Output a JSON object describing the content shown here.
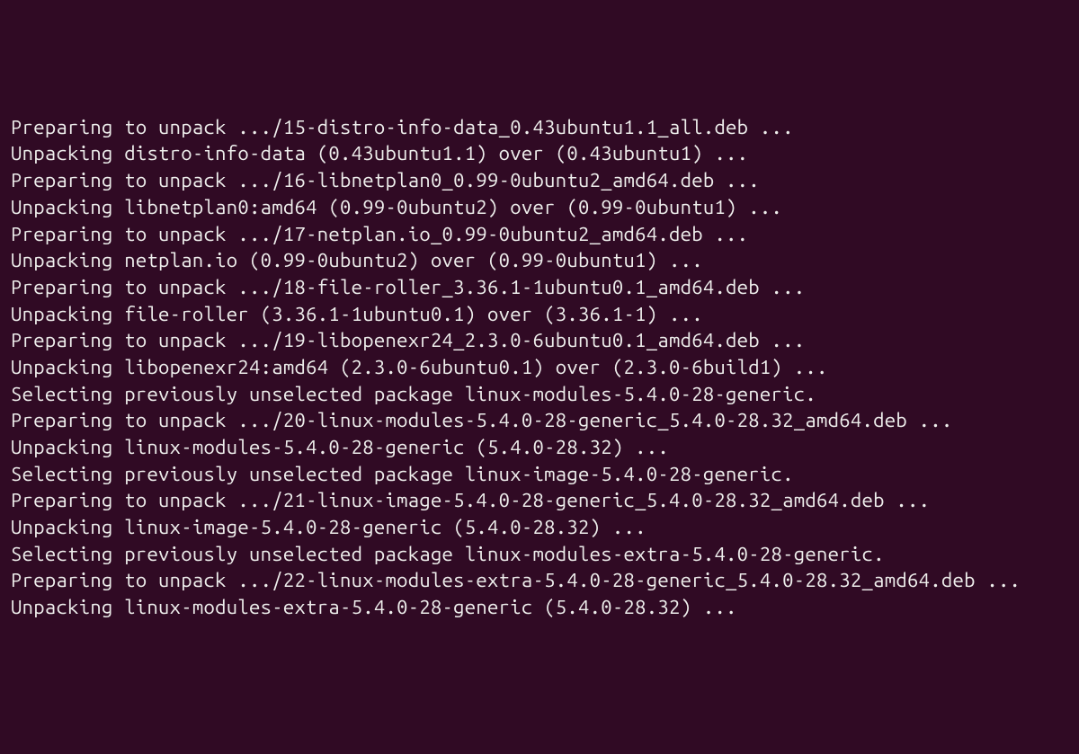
{
  "terminal": {
    "lines": [
      "Preparing to unpack .../15-distro-info-data_0.43ubuntu1.1_all.deb ...",
      "Unpacking distro-info-data (0.43ubuntu1.1) over (0.43ubuntu1) ...",
      "Preparing to unpack .../16-libnetplan0_0.99-0ubuntu2_amd64.deb ...",
      "Unpacking libnetplan0:amd64 (0.99-0ubuntu2) over (0.99-0ubuntu1) ...",
      "Preparing to unpack .../17-netplan.io_0.99-0ubuntu2_amd64.deb ...",
      "Unpacking netplan.io (0.99-0ubuntu2) over (0.99-0ubuntu1) ...",
      "Preparing to unpack .../18-file-roller_3.36.1-1ubuntu0.1_amd64.deb ...",
      "Unpacking file-roller (3.36.1-1ubuntu0.1) over (3.36.1-1) ...",
      "Preparing to unpack .../19-libopenexr24_2.3.0-6ubuntu0.1_amd64.deb ...",
      "Unpacking libopenexr24:amd64 (2.3.0-6ubuntu0.1) over (2.3.0-6build1) ...",
      "Selecting previously unselected package linux-modules-5.4.0-28-generic.",
      "Preparing to unpack .../20-linux-modules-5.4.0-28-generic_5.4.0-28.32_amd64.deb ...",
      "Unpacking linux-modules-5.4.0-28-generic (5.4.0-28.32) ...",
      "Selecting previously unselected package linux-image-5.4.0-28-generic.",
      "Preparing to unpack .../21-linux-image-5.4.0-28-generic_5.4.0-28.32_amd64.deb ...",
      "Unpacking linux-image-5.4.0-28-generic (5.4.0-28.32) ...",
      "Selecting previously unselected package linux-modules-extra-5.4.0-28-generic.",
      "Preparing to unpack .../22-linux-modules-extra-5.4.0-28-generic_5.4.0-28.32_amd64.deb ...",
      "Unpacking linux-modules-extra-5.4.0-28-generic (5.4.0-28.32) ..."
    ]
  }
}
